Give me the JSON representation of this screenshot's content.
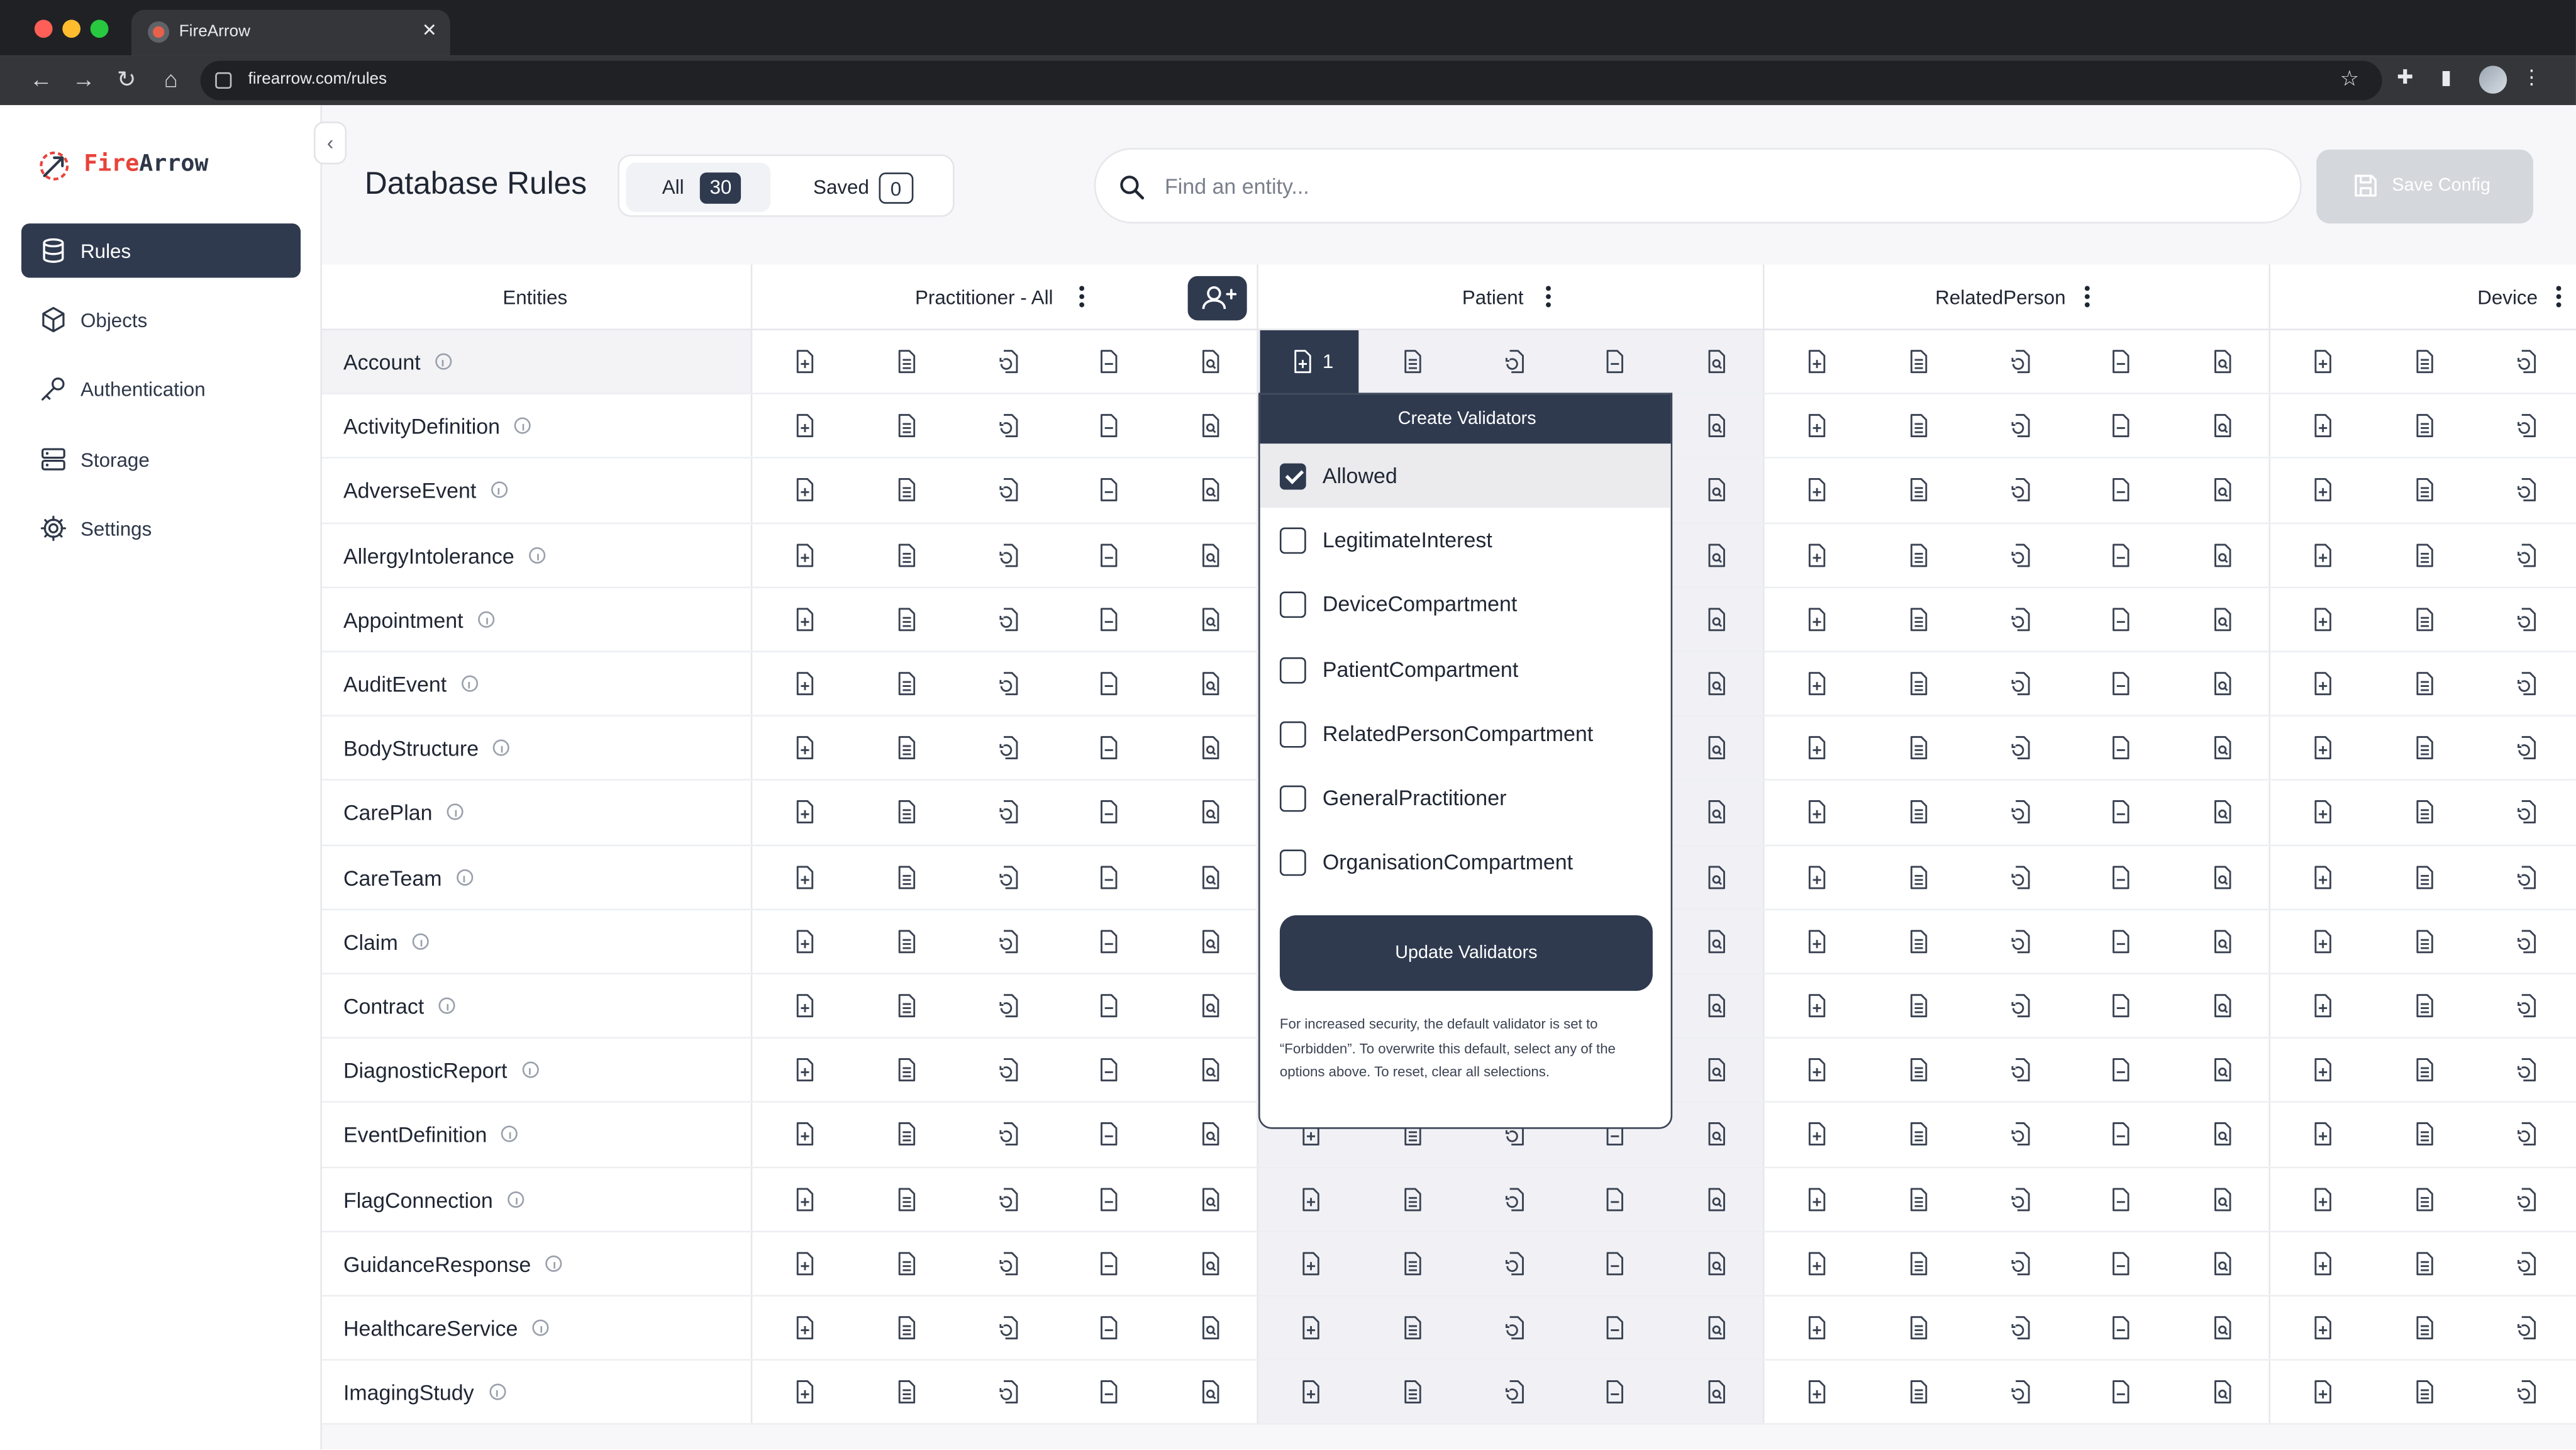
{
  "browser": {
    "tab_title": "FireArrow",
    "url": "firearrow.com/rules"
  },
  "app": {
    "logo_fire": "Fire",
    "logo_arrow": "Arrow"
  },
  "sidebar": {
    "items": [
      {
        "label": "Rules",
        "icon": "database-icon"
      },
      {
        "label": "Objects",
        "icon": "cube-icon"
      },
      {
        "label": "Authentication",
        "icon": "key-icon"
      },
      {
        "label": "Storage",
        "icon": "server-icon"
      },
      {
        "label": "Settings",
        "icon": "gear-icon"
      }
    ]
  },
  "header": {
    "title": "Database Rules",
    "filter_all_label": "All",
    "filter_all_count": "30",
    "filter_saved_label": "Saved",
    "filter_saved_count": "0",
    "search_placeholder": "Find an entity...",
    "save_label": "Save Config"
  },
  "grid": {
    "entities_header": "Entities",
    "columns": [
      {
        "label": "Practitioner - All"
      },
      {
        "label": "Patient"
      },
      {
        "label": "RelatedPerson"
      },
      {
        "label": "Device"
      }
    ],
    "selected_cell_count": "1",
    "rows": [
      "Account",
      "ActivityDefinition",
      "AdverseEvent",
      "AllergyIntolerance",
      "Appointment",
      "AuditEvent",
      "BodyStructure",
      "CarePlan",
      "CareTeam",
      "Claim",
      "Contract",
      "DiagnosticReport",
      "EventDefinition",
      "FlagConnection",
      "GuidanceResponse",
      "HealthcareService",
      "ImagingStudy"
    ]
  },
  "popover": {
    "title": "Create Validators",
    "options": [
      {
        "label": "Allowed",
        "checked": true
      },
      {
        "label": "LegitimateInterest",
        "checked": false
      },
      {
        "label": "DeviceCompartment",
        "checked": false
      },
      {
        "label": "PatientCompartment",
        "checked": false
      },
      {
        "label": "RelatedPersonCompartment",
        "checked": false
      },
      {
        "label": "GeneralPractitioner",
        "checked": false
      },
      {
        "label": "OrganisationCompartment",
        "checked": false
      }
    ],
    "button_label": "Update Validators",
    "note": "For increased security, the default validator is set to “Forbidden”. To overwrite this default, select any of the options above. To reset, clear all selections."
  },
  "colors": {
    "primary": "#2f3a4f",
    "brand_red": "#e8433a",
    "background": "#f7f7f9"
  }
}
